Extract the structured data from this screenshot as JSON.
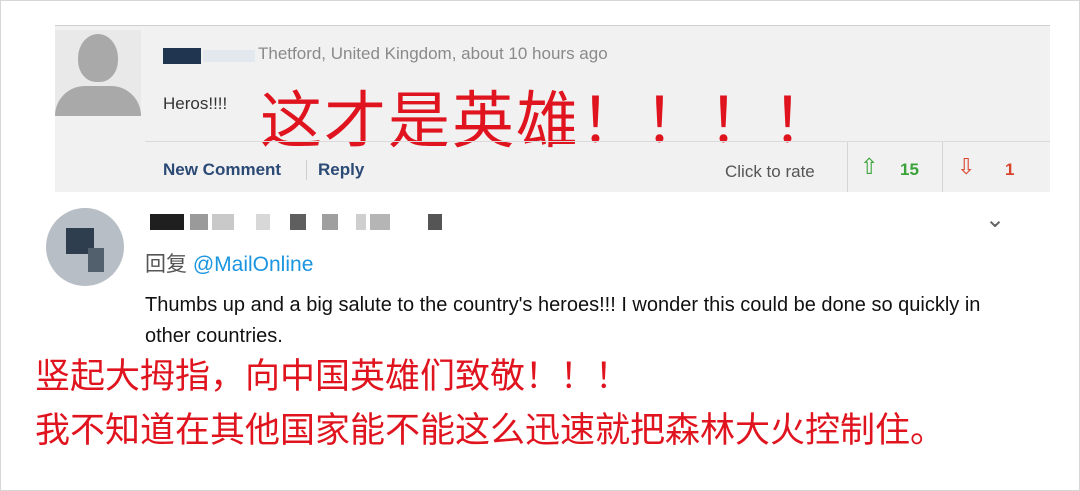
{
  "comment": {
    "meta": "Thetford, United Kingdom, about 10 hours ago",
    "text": "Heros!!!!",
    "translation": "这才是英雄！！！！",
    "actions": {
      "new_comment": "New Comment",
      "reply": "Reply",
      "rate_prompt": "Click to rate"
    },
    "votes": {
      "up": "15",
      "down": "1"
    },
    "colors": {
      "up": "#3ba33b",
      "down": "#d9442e",
      "link": "#2b4a75"
    }
  },
  "tweet": {
    "reply_prefix": "回复",
    "handle": "@MailOnline",
    "text": "Thumbs up and a big salute to the country's heroes!!! I wonder this could be done so quickly in other countries.",
    "translation_line1": "竖起大拇指，向中国英雄们致敬！！！",
    "translation_line2": "我不知道在其他国家能不能这么迅速就把森林大火控制住。",
    "colors": {
      "handle": "#1b95e0",
      "annotation": "#e0141e"
    }
  },
  "icons": {
    "avatar": "avatar-icon",
    "up": "thumbs-up-arrow-icon",
    "down": "thumbs-down-arrow-icon",
    "menu": "chevron-down-icon"
  }
}
